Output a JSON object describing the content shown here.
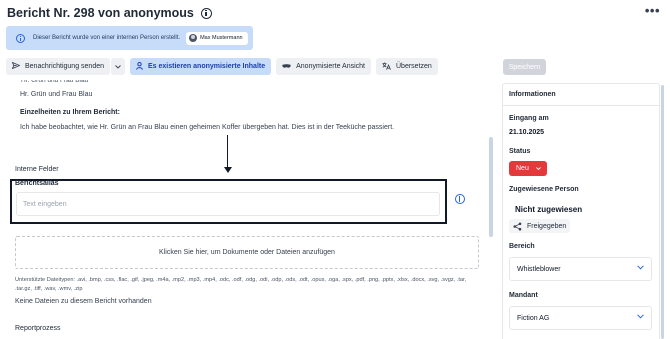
{
  "header": {
    "title": "Bericht Nr. 298 von anonymous",
    "more_menu": "•••"
  },
  "banner": {
    "text": "Dieser Bericht wurde von einer internen Person erstellt.",
    "user_name": "Max Mustermann"
  },
  "toolbar": {
    "send_notification": "Benachrichtigung senden",
    "anonymized_exists": "Es existieren anonymisierte Inhalte",
    "anonymized_view": "Anonymisierte Ansicht",
    "translate": "Übersetzen",
    "save": "Speichern"
  },
  "report": {
    "clipped_line": "Hr. Grün und Frau Blau",
    "names": "Hr. Grün und Frau Blau",
    "details_label": "Einzelheiten zu Ihrem Bericht:",
    "details_text": "Ich habe beobachtet, wie Hr. Grün an Frau Blau einen geheimen Koffer übergeben hat. Dies ist in der Teeküche passiert.",
    "internal_fields": "Interne Felder",
    "alias_label": "Berichtsalias",
    "alias_placeholder": "Text eingeben",
    "dropzone": "Klicken Sie hier, um Dokumente oder Dateien anzufügen",
    "supported_types": "Unterstützte Dateitypen: .avi, .bmp, .css, .flac, .gif, .jpeg, .m4a, .mp2, .mp3, .mp4, .odc, .odf, .odg, .odi, .odp, .ods, .odt, .opus, .oga, .spx, .pdf, .png, .pptx, .xlsx, .docx, .svg, .svgz, .tar, .tar.gz, .tiff, .wav, .wmv, .zip",
    "no_files": "Keine Dateien zu diesem Bericht vorhanden",
    "report_process": "Reportprozess"
  },
  "sidebar": {
    "title": "Informationen",
    "received_label": "Eingang am",
    "received_value": "21.10.2025",
    "status_label": "Status",
    "status_value": "Neu",
    "assigned_label": "Zugewiesene Person",
    "assigned_value": "Nicht zugewiesen",
    "share": "Freigegeben",
    "area_label": "Bereich",
    "area_value": "Whistleblower",
    "client_label": "Mandant",
    "client_value": "Fiction AG"
  },
  "colors": {
    "banner_bg": "#c7dcf8",
    "primary_text": "#1e40af",
    "status_new": "#e5383b",
    "save_disabled": "#d1d5db"
  },
  "icons": [
    "info-icon",
    "send-icon",
    "chevron-down-icon",
    "user-icon",
    "mask-icon",
    "translate-icon",
    "share-icon"
  ]
}
